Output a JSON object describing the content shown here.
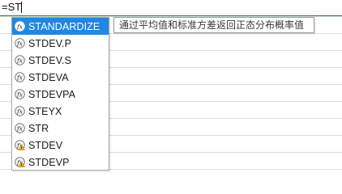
{
  "formula_bar": {
    "text": "=ST"
  },
  "autocomplete": {
    "items": [
      {
        "label": "STANDARDIZE",
        "icon": "function-icon",
        "selected": true,
        "warning": false
      },
      {
        "label": "STDEV.P",
        "icon": "function-icon",
        "selected": false,
        "warning": false
      },
      {
        "label": "STDEV.S",
        "icon": "function-icon",
        "selected": false,
        "warning": false
      },
      {
        "label": "STDEVA",
        "icon": "function-icon",
        "selected": false,
        "warning": false
      },
      {
        "label": "STDEVPA",
        "icon": "function-icon",
        "selected": false,
        "warning": false
      },
      {
        "label": "STEYX",
        "icon": "function-icon",
        "selected": false,
        "warning": false
      },
      {
        "label": "STR",
        "icon": "function-icon",
        "selected": false,
        "warning": false
      },
      {
        "label": "STDEV",
        "icon": "compat-function-warning-icon",
        "selected": false,
        "warning": true
      },
      {
        "label": "STDEVP",
        "icon": "compat-function-warning-icon",
        "selected": false,
        "warning": true
      }
    ]
  },
  "tooltip": {
    "text": "通过平均值和标准方差返回正态分布概率值"
  },
  "colors": {
    "selection": "#1e88e5",
    "formula_underline": "#2e7d32",
    "gridline": "#dcdcdc",
    "warning": "#f5b400"
  }
}
